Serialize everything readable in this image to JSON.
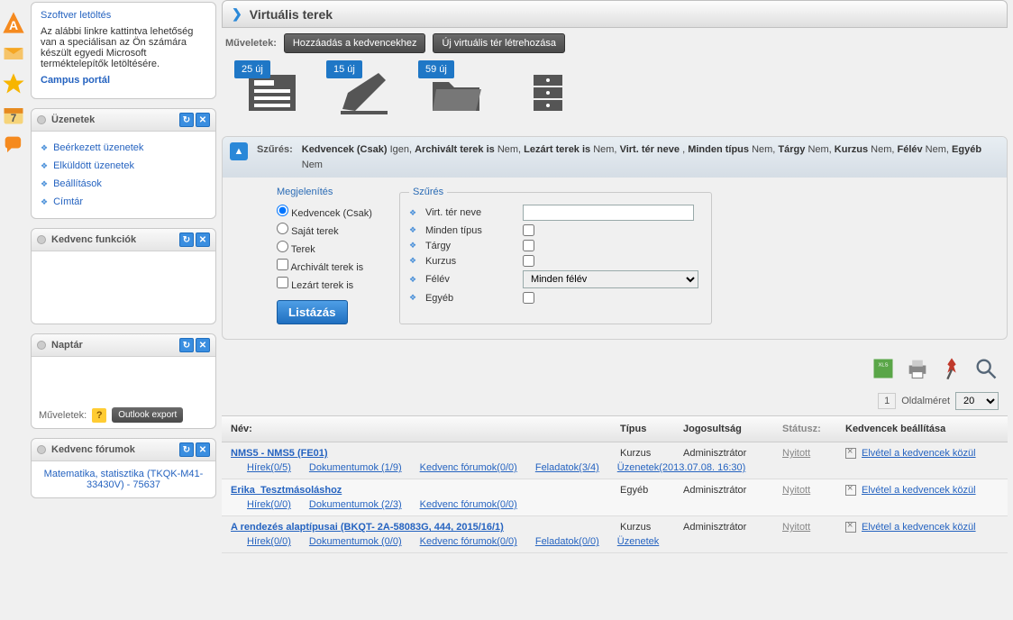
{
  "sidebar": {
    "download": {
      "title": "Szoftver letöltés",
      "text": "Az alábbi linkre kattintva lehetőség van a speciálisan az Ön számára készült egyedi Microsoft terméktelepítők letöltésére.",
      "link": "Campus portál"
    },
    "messages": {
      "title": "Üzenetek",
      "items": [
        "Beérkezett üzenetek",
        "Elküldött üzenetek",
        "Beállítások",
        "Címtár"
      ]
    },
    "favfn": {
      "title": "Kedvenc funkciók"
    },
    "calendar": {
      "title": "Naptár"
    },
    "outlook_row": {
      "label": "Műveletek:",
      "btn": "Outlook export"
    },
    "favforum": {
      "title": "Kedvenc fórumok",
      "item": "Matematika, statisztika (TKQK-M41-33430V) - 75637"
    }
  },
  "main": {
    "title": "Virtuális terek",
    "ops_label": "Műveletek:",
    "add_fav": "Hozzáadás a kedvencekhez",
    "new_space": "Új virtuális tér létrehozása",
    "tiles": {
      "news": "25 új",
      "pencil": "15 új",
      "folder": "59 új"
    },
    "filter": {
      "label": "Szűrés:",
      "summary_html": "<b>Kedvencek (Csak)</b> Igen, <b>Archivált terek is</b> Nem, <b>Lezárt terek is</b> Nem, <b>Virt. tér neve</b> , <b>Minden típus</b> Nem, <b>Tárgy</b> Nem, <b>Kurzus</b> Nem, <b>Félév</b> Nem, <b>Egyéb</b> Nem",
      "display_title": "Megjelenítés",
      "opts": [
        "Kedvencek (Csak)",
        "Saját terek",
        "Terek",
        "Archivált terek is",
        "Lezárt terek is"
      ],
      "list_btn": "Listázás",
      "right_title": "Szűrés",
      "name_lbl": "Virt. tér neve",
      "type_lbl": "Minden típus",
      "targy_lbl": "Tárgy",
      "kurzus_lbl": "Kurzus",
      "felev_lbl": "Félév",
      "felev_val": "Minden félév",
      "egyeb_lbl": "Egyéb"
    },
    "page_label": "Oldalméret",
    "page_num": "1",
    "page_size": "20",
    "thead": {
      "name": "Név:",
      "type": "Típus",
      "role": "Jogosultság",
      "status": "Státusz:",
      "fav": "Kedvencek beállítása"
    },
    "rows": [
      {
        "name": "NMS5 - NMS5 (FE01)",
        "type": "Kurzus",
        "role": "Adminisztrátor",
        "status": "Nyitott",
        "fav": "Elvétel a kedvencek közül",
        "links": [
          "Hírek(0/5)",
          "Dokumentumok (1/9)",
          "Kedvenc fórumok(0/0)",
          "Feladatok(3/4)",
          "Üzenetek(2013.07.08. 16:30)"
        ]
      },
      {
        "name": "Erika_Tesztmásoláshoz",
        "type": "Egyéb",
        "role": "Adminisztrátor",
        "status": "Nyitott",
        "fav": "Elvétel a kedvencek közül",
        "links": [
          "Hírek(0/0)",
          "Dokumentumok (2/3)",
          "Kedvenc fórumok(0/0)"
        ]
      },
      {
        "name": "A rendezés alaptípusai (BKQT- 2A-58083G, 444, 2015/16/1)",
        "type": "Kurzus",
        "role": "Adminisztrátor",
        "status": "Nyitott",
        "fav": "Elvétel a kedvencek közül",
        "links": [
          "Hírek(0/0)",
          "Dokumentumok (0/0)",
          "Kedvenc fórumok(0/0)",
          "Feladatok(0/0)",
          "Üzenetek"
        ]
      }
    ]
  }
}
